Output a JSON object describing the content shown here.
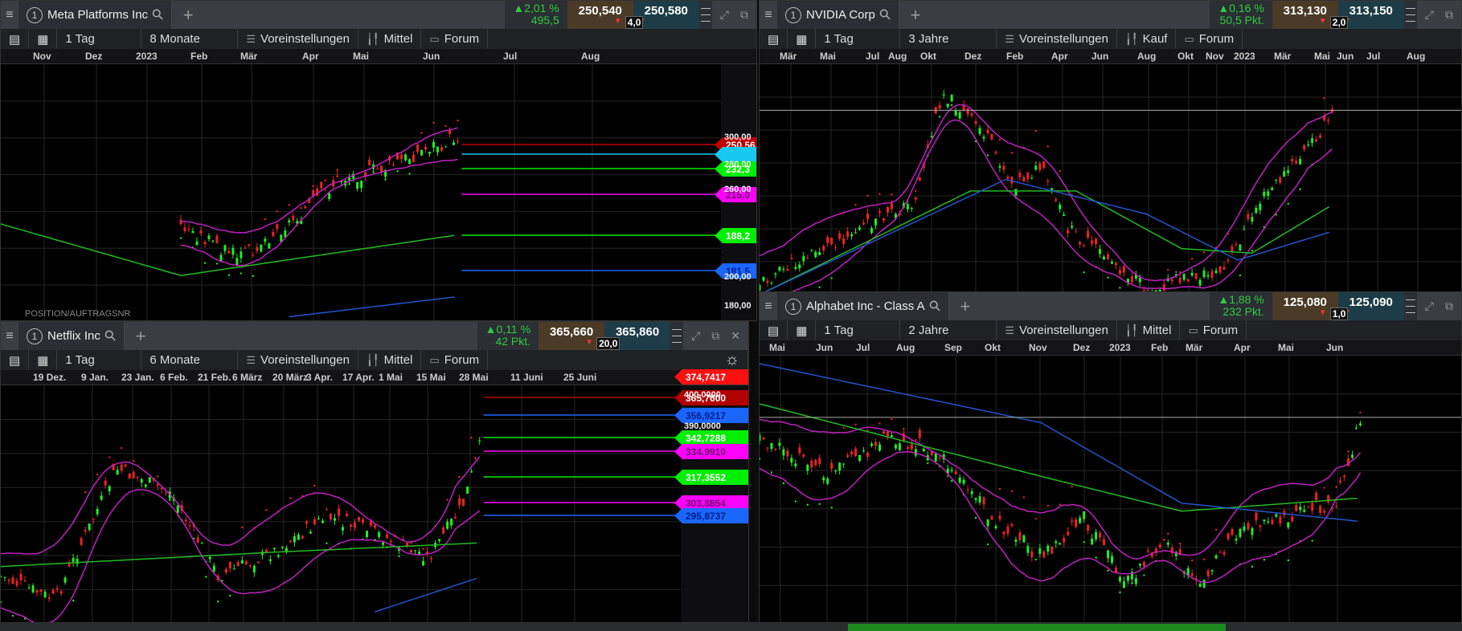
{
  "panels": [
    {
      "id": "meta",
      "title": "Meta Platforms Inc",
      "tab_num": "1",
      "change_pct": "2,01 %",
      "change_pts": "495,5",
      "bid": "250,540",
      "ask": "250,580",
      "spread": "4,0",
      "interval": "1 Tag",
      "range": "8 Monate",
      "settings": "Voreinstellungen",
      "price_type": "Mittel",
      "forum": "Forum",
      "dates": [
        "Nov",
        "Dez",
        "2023",
        "Feb",
        "Mär",
        "Apr",
        "Mai",
        "Jun",
        "Jul",
        "Aug"
      ],
      "price_labels": [
        "300,00",
        "280,00",
        "260,00",
        "200,00",
        "180,00"
      ],
      "price_tags": [
        {
          "label": "250,56",
          "color": "#c00000",
          "text": "#fff"
        },
        {
          "label": "",
          "color": "#18c8f0",
          "text": "#000"
        },
        {
          "label": "232,3",
          "color": "#00ee00",
          "text": "#fff"
        },
        {
          "label": "215,0",
          "color": "#ff00ff",
          "text": "#700070"
        },
        {
          "label": "188,2",
          "color": "#00ee00",
          "text": "#fff"
        },
        {
          "label": "181,5",
          "color": "#1a66ff",
          "text": "#00208a"
        }
      ],
      "footer": "POSITION/AUFTRAGSNR"
    },
    {
      "id": "netflix",
      "title": "Netflix Inc",
      "tab_num": "1",
      "change_pct": "0,11 %",
      "change_pts": "42 Pkt.",
      "bid": "365,660",
      "ask": "365,860",
      "spread": "20,0",
      "interval": "1 Tag",
      "range": "6 Monate",
      "settings": "Voreinstellungen",
      "price_type": "Mittel",
      "forum": "Forum",
      "dates": [
        "19 Dez.",
        "9 Jan.",
        "23 Jan.",
        "6 Feb.",
        "21 Feb.",
        "6 März",
        "20 März",
        "3 Apr.",
        "17 Apr.",
        "1 Mai",
        "15 Mai",
        "28 Mai",
        "11 Juni",
        "25 Juni"
      ],
      "price_labels": [
        "400,0000",
        "390,0000"
      ],
      "price_tags": [
        {
          "label": "374,7417",
          "color": "#ff1010",
          "text": "#fff"
        },
        {
          "label": "365,7600",
          "color": "#b00000",
          "text": "#fff"
        },
        {
          "label": "356,9217",
          "color": "#1a66ff",
          "text": "#00208a"
        },
        {
          "label": "342,7288",
          "color": "#00ee00",
          "text": "#fff"
        },
        {
          "label": "334,9910",
          "color": "#ff00ff",
          "text": "#700070"
        },
        {
          "label": "317,3552",
          "color": "#00ee00",
          "text": "#fff"
        },
        {
          "label": "303,8854",
          "color": "#ff00ff",
          "text": "#700070"
        },
        {
          "label": "295,8737",
          "color": "#1a66ff",
          "text": "#00208a"
        }
      ]
    },
    {
      "id": "nvidia",
      "title": "NVIDIA Corp",
      "tab_num": "1",
      "change_pct": "0,16 %",
      "change_pts": "50,5 Pkt.",
      "bid": "313,130",
      "ask": "313,150",
      "spread": "2,0",
      "interval": "1 Tag",
      "range": "3 Jahre",
      "settings": "Voreinstellungen",
      "price_type": "Kauf",
      "forum": "Forum",
      "dates": [
        "Mär",
        "Mai",
        "Jul",
        "Aug",
        "Okt",
        "Dez",
        "Feb",
        "Apr",
        "Jun",
        "Aug",
        "Okt",
        "Nov",
        "2023",
        "Mär",
        "Mai",
        "Jun",
        "Jul",
        "Aug"
      ],
      "price_labels": [],
      "price_tags": []
    },
    {
      "id": "alphabet",
      "title": "Alphabet Inc - Class A",
      "tab_num": "1",
      "change_pct": "1,88 %",
      "change_pts": "232 Pkt.",
      "bid": "125,080",
      "ask": "125,090",
      "spread": "1,0",
      "interval": "1 Tag",
      "range": "2 Jahre",
      "settings": "Voreinstellungen",
      "price_type": "Mittel",
      "forum": "Forum",
      "dates": [
        "Mai",
        "Jun",
        "Jul",
        "Aug",
        "Sep",
        "Okt",
        "Nov",
        "Dez",
        "2023",
        "Feb",
        "Mär",
        "Apr",
        "Mai",
        "Jun"
      ],
      "price_labels": [],
      "price_tags": []
    }
  ],
  "colors": {
    "up": "#22ee22",
    "down": "#ee2222",
    "bollinger": "#c020c0",
    "sma_short": "#22bb22",
    "sma_long": "#2255cc"
  }
}
